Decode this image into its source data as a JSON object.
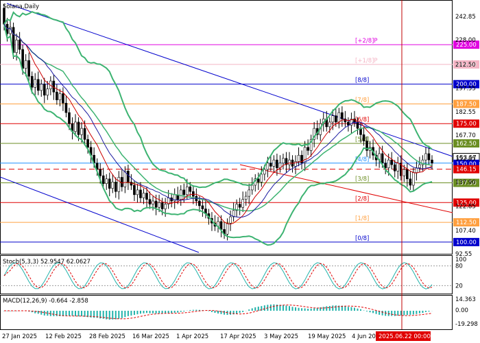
{
  "chart_data": [
    {
      "type": "candlestick",
      "title": "Solana,Daily",
      "y_ticks": [
        242.85,
        228.0,
        212.5,
        197.55,
        182.55,
        167.7,
        152.85,
        137.9,
        122.85,
        107.4,
        92.55
      ],
      "ylim": [
        92.55,
        252
      ],
      "x_ticks": [
        "27 Jan 2025",
        "12 Feb 2025",
        "28 Feb 2025",
        "16 Mar 2025",
        "1 Apr 2025",
        "17 Apr 2025",
        "3 May 2025",
        "19 May 2025",
        "4 Jun 2025"
      ],
      "cursor_time": "2025.06.22 00:00",
      "current_price": "153.57",
      "current_price_secondary": "150.00",
      "price_line": "146.15",
      "murrey_levels": [
        {
          "label": "[+2/8]P",
          "price": "225.00",
          "color": "#e000e0"
        },
        {
          "label": "[+1/8]P",
          "price": "212.50",
          "color": "#f4b4c4"
        },
        {
          "label": "[8/8]",
          "price": "200.00",
          "color": "#0000cc"
        },
        {
          "label": "[7/8]",
          "price": "187.50",
          "color": "#ffa040"
        },
        {
          "label": "[6/8]",
          "price": "175.00",
          "color": "#e00000"
        },
        {
          "label": "[5/8]",
          "price": "162.50",
          "color": "#6b8e23"
        },
        {
          "label": "[4/8]",
          "price": "150.00",
          "color": "#1e90ff"
        },
        {
          "label": "[3/8]",
          "price": "137.50",
          "color": "#6b8e23"
        },
        {
          "label": "[2/8]",
          "price": "125.00",
          "color": "#e00000"
        },
        {
          "label": "[1/8]",
          "price": "112.50",
          "color": "#ffa040"
        },
        {
          "label": "[0/8]",
          "price": "100.00",
          "color": "#0000cc"
        }
      ],
      "closes": [
        238,
        232,
        236,
        220,
        228,
        222,
        210,
        215,
        205,
        198,
        203,
        196,
        200,
        193,
        197,
        202,
        195,
        190,
        194,
        188,
        182,
        175,
        170,
        176,
        168,
        172,
        165,
        160,
        155,
        150,
        146,
        142,
        137,
        140,
        134,
        138,
        132,
        141,
        135,
        145,
        138,
        136,
        130,
        133,
        128,
        131,
        127,
        124,
        126,
        122,
        125,
        121,
        124,
        128,
        126,
        130,
        127,
        133,
        130,
        135,
        132,
        129,
        126,
        123,
        121,
        118,
        115,
        112,
        110,
        113,
        108,
        105,
        112,
        116,
        120,
        124,
        122,
        127,
        129,
        133,
        136,
        140,
        138,
        143,
        146,
        150,
        148,
        152,
        147,
        150,
        153,
        149,
        152,
        148,
        151,
        155,
        150,
        160,
        158,
        165,
        172,
        168,
        175,
        178,
        173,
        176,
        180,
        176,
        182,
        178,
        176,
        174,
        178,
        176,
        172,
        168,
        164,
        158,
        160,
        155,
        152,
        156,
        150,
        147,
        152,
        149,
        145,
        150,
        142,
        146,
        140,
        136,
        144,
        147,
        149,
        152,
        156,
        152,
        150
      ]
    },
    {
      "type": "line",
      "title": "Stoch(5,3,3) 52.9547 62.0627",
      "y_ticks": [
        "100",
        "80",
        "20"
      ],
      "series": [
        {
          "name": "main"
        },
        {
          "name": "signal"
        }
      ]
    },
    {
      "type": "histogram",
      "title": "MACD(12,26,9) -0.664 -2.858",
      "y_ticks": [
        "14.363",
        "0.00",
        "-19.298"
      ]
    }
  ],
  "colors": {
    "candle": "#000000",
    "bollinger": "#3cb371",
    "trend_channel": "#0000cd",
    "red_trend": "#e00000",
    "cursor": "#c00000",
    "price_label_bg": "#e00000",
    "current_label_bg": "#0000cc"
  }
}
